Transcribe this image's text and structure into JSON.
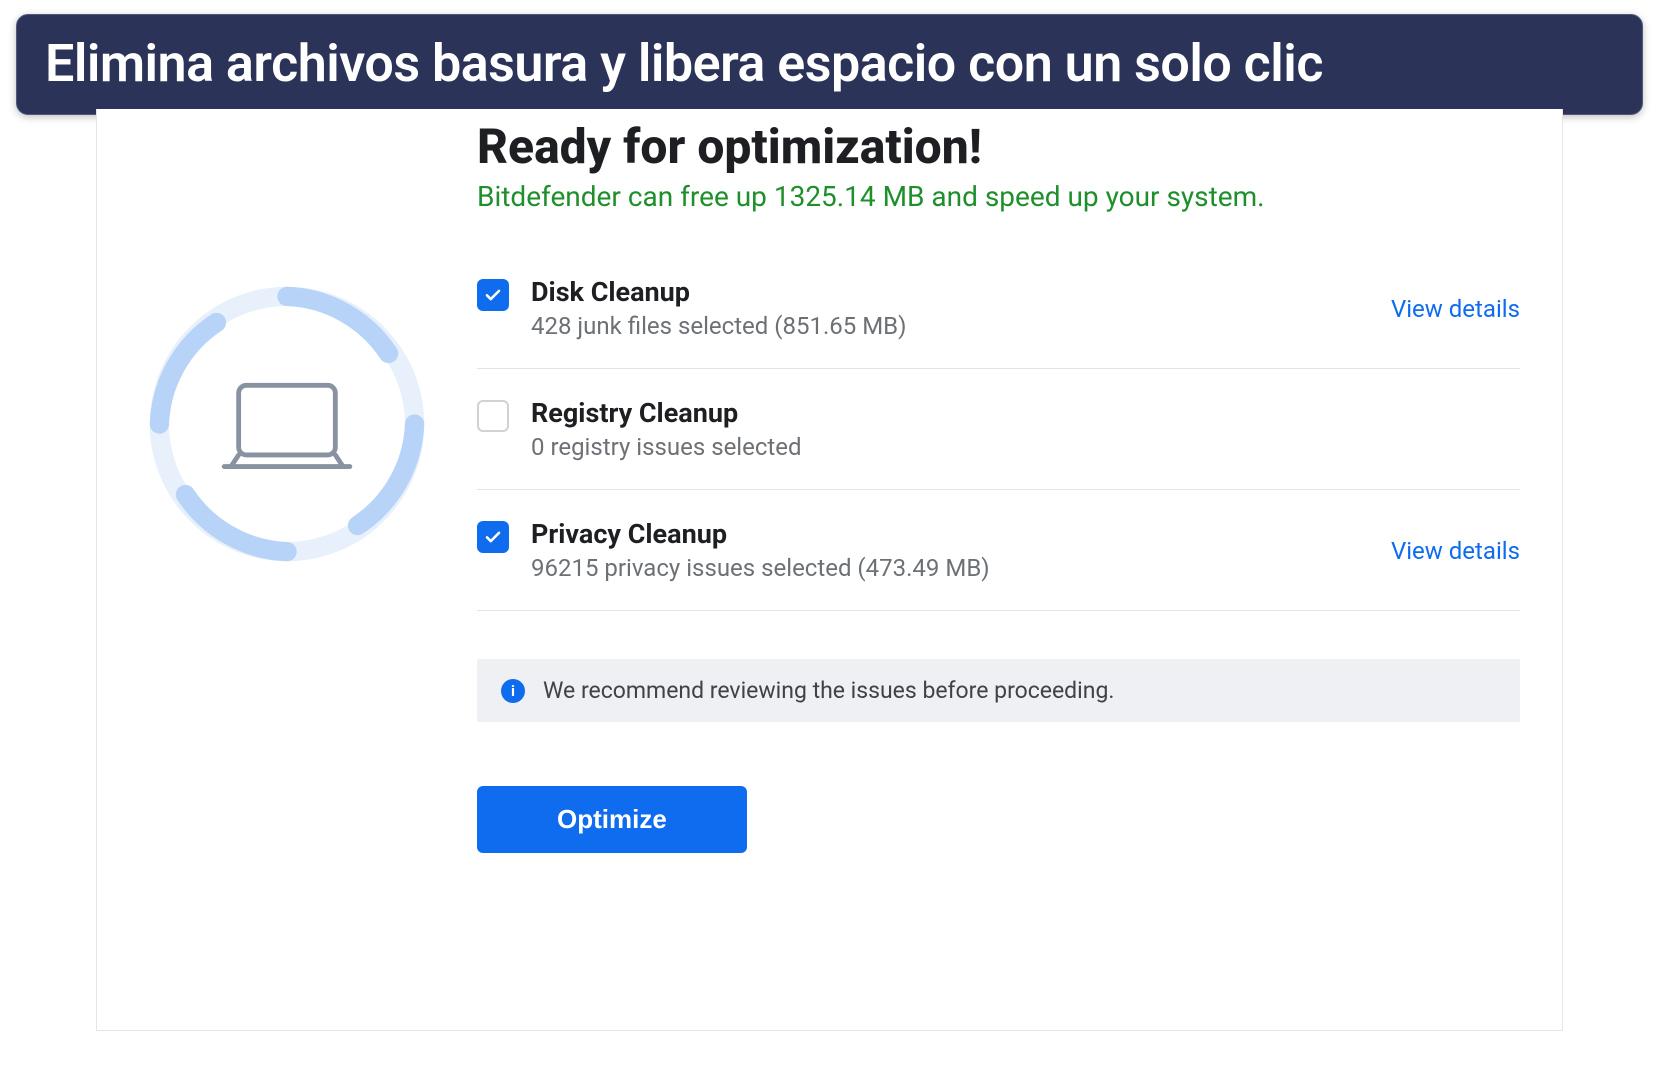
{
  "banner": {
    "text": "Elimina archivos basura y libera espacio con un solo clic"
  },
  "panel": {
    "heading": "Ready for optimization!",
    "subtitle": "Bitdefender can free up 1325.14 MB and speed up your system.",
    "items": [
      {
        "checked": true,
        "title": "Disk Cleanup",
        "desc": "428 junk files selected (851.65 MB)",
        "view_details": "View details"
      },
      {
        "checked": false,
        "title": "Registry Cleanup",
        "desc": "0 registry issues selected",
        "view_details": ""
      },
      {
        "checked": true,
        "title": "Privacy Cleanup",
        "desc": "96215 privacy issues selected (473.49 MB)",
        "view_details": "View details"
      }
    ],
    "note": {
      "text": "We recommend reviewing the issues before proceeding."
    },
    "optimize_button": "Optimize"
  },
  "colors": {
    "accent": "#0f6cee",
    "banner_bg": "#2b3358",
    "subtitle_green": "#1e8f2b"
  }
}
